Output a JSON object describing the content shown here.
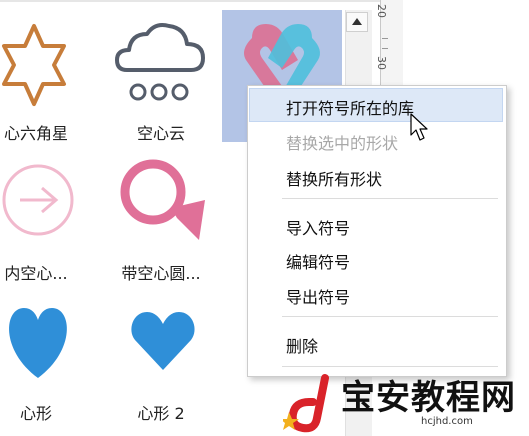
{
  "gallery": {
    "tiles": [
      {
        "label": "心六角星",
        "icon": "hexagram-outline-icon",
        "color": "#c77d3a"
      },
      {
        "label": "空心云",
        "icon": "snow-cloud-icon",
        "color": "#555d6b"
      },
      {
        "label": "",
        "icon": "interlocked-hearts-icon",
        "color": "#d8789b"
      },
      {
        "label": "内空心...",
        "icon": "circle-arrow-icon",
        "color": "#f1b9cd"
      },
      {
        "label": "带空心圆...",
        "icon": "circle-with-arrow-icon",
        "color": "#e07098"
      },
      {
        "label": "心形",
        "icon": "heart-icon",
        "color": "#2f8fd8"
      },
      {
        "label": "心形 2",
        "icon": "heart-2-icon",
        "color": "#2f8fd8"
      }
    ]
  },
  "ruler": {
    "labels": [
      "20",
      "30"
    ]
  },
  "context_menu": {
    "items": [
      {
        "label": "打开符号所在的库",
        "enabled": true,
        "highlighted": true
      },
      {
        "label": "替换选中的形状",
        "enabled": false
      },
      {
        "label": "替换所有形状",
        "enabled": true
      },
      {
        "label": "导入符号",
        "enabled": true
      },
      {
        "label": "编辑符号",
        "enabled": true
      },
      {
        "label": "导出符号",
        "enabled": true
      },
      {
        "label": "删除",
        "enabled": true
      }
    ]
  },
  "watermark": {
    "text": "宝安教程网",
    "url": "hcjhd.com",
    "colors": {
      "red": "#d9232a",
      "yellow": "#f2b01e"
    }
  }
}
